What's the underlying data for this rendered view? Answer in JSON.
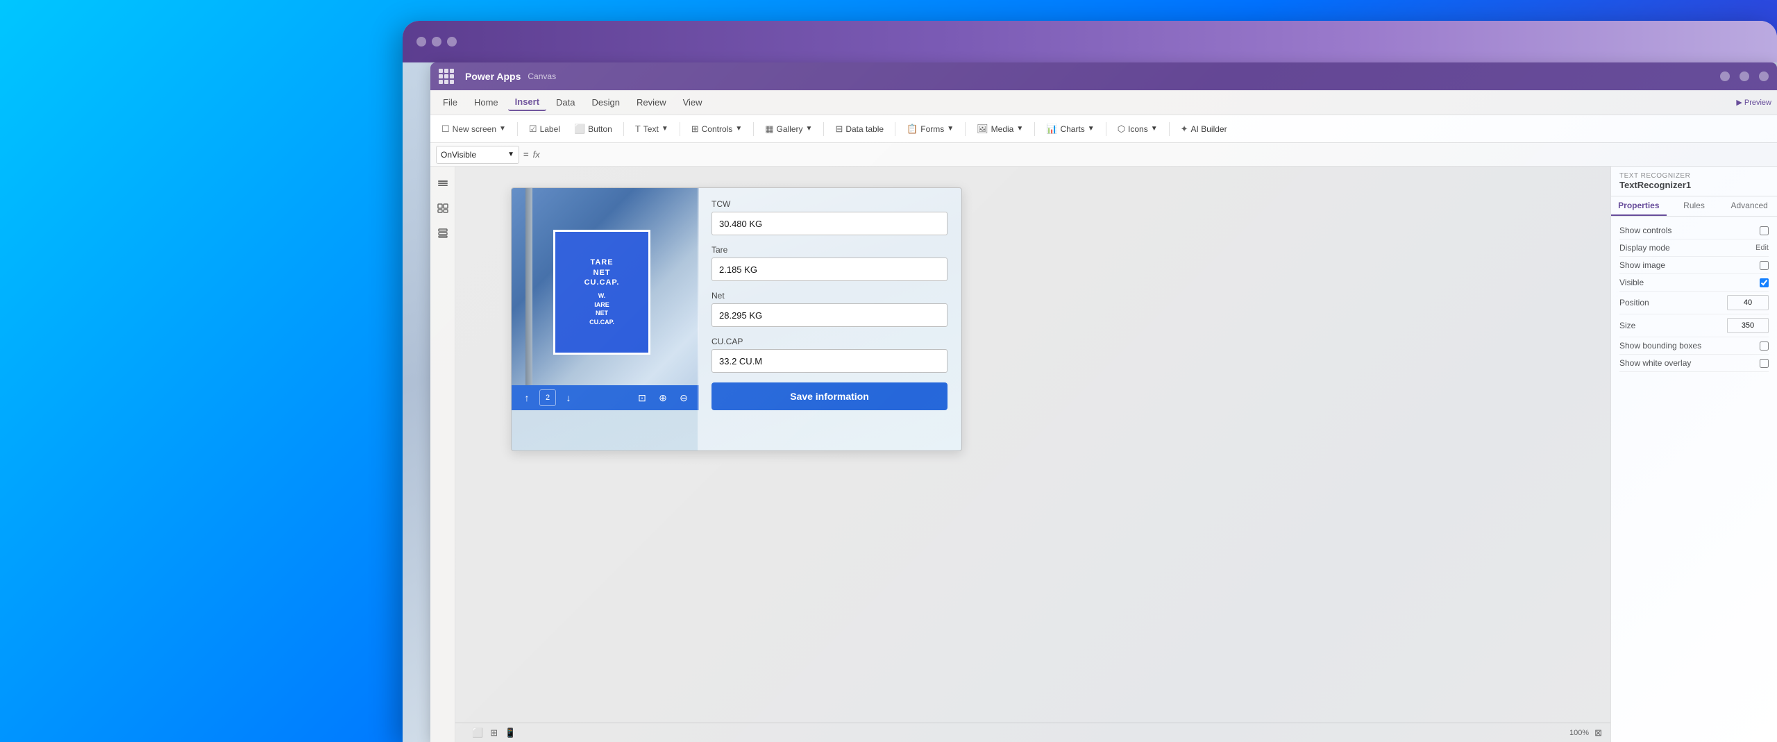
{
  "app": {
    "name": "Power Apps",
    "subtitle": "Canvas"
  },
  "title_bar": {
    "buttons": [
      "minimize",
      "maximize",
      "close"
    ]
  },
  "menu": {
    "items": [
      "File",
      "Home",
      "Insert",
      "Data",
      "Design",
      "Review",
      "View"
    ],
    "active": "Insert"
  },
  "toolbar": {
    "new_screen": "New screen",
    "label": "Label",
    "button": "Button",
    "text": "Text",
    "controls": "Controls",
    "gallery": "Gallery",
    "data_table": "Data table",
    "forms": "Forms",
    "media": "Media",
    "charts": "Charts",
    "icons": "Icons",
    "ai_builder": "AI Builder"
  },
  "formula_bar": {
    "property": "OnVisible",
    "eq": "=",
    "fx": "fx"
  },
  "panel": {
    "type": "TEXT RECOGNIZER",
    "name": "TextRecognizer1",
    "tabs": [
      "Properties",
      "Rules",
      "Advanced"
    ],
    "active_tab": "Properties",
    "preview_label": "Preview",
    "props": [
      {
        "label": "Show controls",
        "value": ""
      },
      {
        "label": "Display mode",
        "value": "Edit"
      },
      {
        "label": "Show image",
        "value": ""
      },
      {
        "label": "Visible",
        "value": ""
      },
      {
        "label": "Position",
        "value": "40"
      },
      {
        "label": "Size",
        "value": "350"
      },
      {
        "label": "Show bounding boxes",
        "value": ""
      },
      {
        "label": "Show white overlay",
        "value": ""
      }
    ]
  },
  "canvas": {
    "fields": [
      {
        "label": "TCW",
        "value": "30.480 KG"
      },
      {
        "label": "Tare",
        "value": "2.185 KG"
      },
      {
        "label": "Net",
        "value": "28.295 KG"
      },
      {
        "label": "CU.CAP",
        "value": "33.2 CU.M"
      }
    ],
    "save_btn": "Save information",
    "sign_lines": [
      "TARE",
      "NET",
      "CU.CAP"
    ],
    "scan_icons": [
      "↑",
      "2",
      "↓",
      "⊡",
      "⊕",
      "⊖"
    ]
  },
  "status_bar": {
    "zoom": "100%",
    "icons": [
      "screen-1",
      "screen-2",
      "screen-3"
    ]
  }
}
